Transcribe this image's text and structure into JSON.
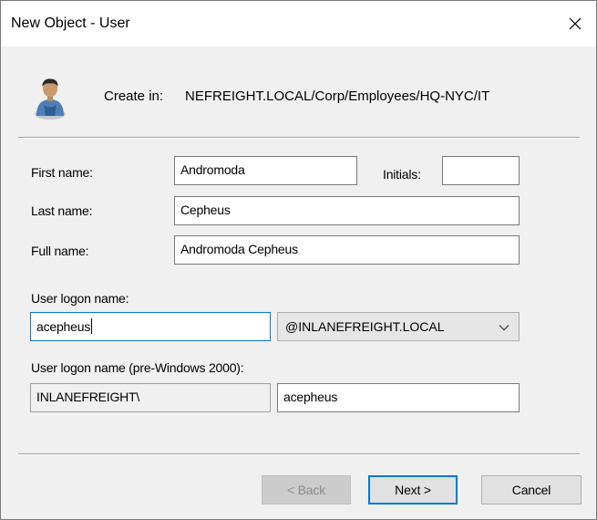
{
  "window": {
    "title": "New Object - User"
  },
  "header": {
    "create_in_label": "Create in:",
    "create_in_path": "\tNEFREIGHT.LOCAL/Corp/Employees/HQ-NYC/IT"
  },
  "form": {
    "first_name_label": "First name:",
    "first_name_value": "Andromoda",
    "initials_label": "Initials:",
    "initials_value": "",
    "last_name_label": "Last name:",
    "last_name_value": "Cepheus",
    "full_name_label": "Full name:",
    "full_name_value": "Andromoda Cepheus",
    "logon_label": "User logon name:",
    "logon_value": "acepheus",
    "domain_suffix": "@INLANEFREIGHT.LOCAL",
    "pre2000_label": "User logon name (pre-Windows 2000):",
    "pre2000_domain": "INLANEFREIGHT\\",
    "pre2000_value": "acepheus"
  },
  "buttons": {
    "back": "< Back",
    "next": "Next >",
    "cancel": "Cancel"
  },
  "icons": {
    "close": "close-icon",
    "user": "user-icon",
    "dropdown": "chevron-down-icon"
  },
  "colors": {
    "focus_border": "#0078d7",
    "dialog_bg": "#f0f0f0"
  }
}
